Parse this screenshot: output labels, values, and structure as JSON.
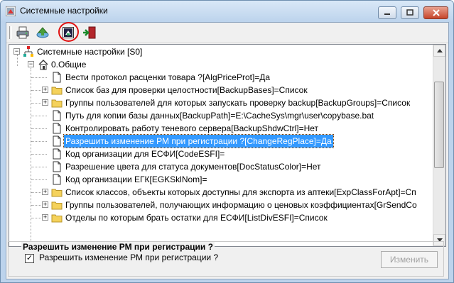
{
  "window": {
    "title": "Системные настройки"
  },
  "toolbar": {
    "buttons": [
      {
        "icon": "printer-icon"
      },
      {
        "icon": "refresh-icon"
      },
      {
        "icon": "settings-dialog-icon",
        "highlighted": true
      },
      {
        "icon": "exit-door-icon"
      }
    ]
  },
  "tree": {
    "root_label": "Системные настройки [S0]",
    "group_label": "0.Общие",
    "items": [
      {
        "label": "Вести протокол расценки товара ?[AlgPriceProt]=Да",
        "type": "leaf",
        "expandable": false
      },
      {
        "label": "Список баз для проверки целостности[BackupBases]=Список",
        "type": "folder",
        "expandable": true
      },
      {
        "label": "Группы пользователей для которых запускать проверку backup[BackupGroups]=Список",
        "type": "folder",
        "expandable": true
      },
      {
        "label": "Путь для копии базы данных[BackupPath]=E:\\CacheSys\\mgr\\user\\copybase.bat",
        "type": "leaf",
        "expandable": false
      },
      {
        "label": "Контролировать работу теневого сервера[BackupShdwCtrl]=Нет",
        "type": "leaf",
        "expandable": false
      },
      {
        "label": "Разрешить изменение РМ при регистрации ?[ChangeRegPlace]=Да",
        "type": "leaf",
        "expandable": false,
        "selected": true
      },
      {
        "label": "Код организации для ЕСФИ[CodeESFI]=",
        "type": "leaf",
        "expandable": false
      },
      {
        "label": "Разрешение цвета для статуса документов[DocStatusColor]=Нет",
        "type": "leaf",
        "expandable": false
      },
      {
        "label": "Код организации ЕГК[EGKSklNom]=",
        "type": "leaf",
        "expandable": false
      },
      {
        "label": "Список классов, объекты которых доступны для экспорта из аптеки[ExpClassForApt]=Сп",
        "type": "folder",
        "expandable": true
      },
      {
        "label": "Группы пользователей, получающих информацию о ценовых коэффициентах[GrSendCo",
        "type": "folder",
        "expandable": true
      },
      {
        "label": "Отделы по которым брать остатки для ЕСФИ[ListDivESFI]=Список",
        "type": "folder",
        "expandable": true
      }
    ]
  },
  "details": {
    "legend": "Разрешить изменение РМ при регистрации ?",
    "checkbox_label": "Разрешить изменение РМ при регистрации ?",
    "checkbox_checked": true,
    "checkbox_mark": "✓",
    "change_button": "Изменить",
    "change_button_enabled": false
  },
  "colors": {
    "selection": "#3399ff",
    "highlight_ring": "#e01010",
    "folder": "#f5d25b"
  }
}
